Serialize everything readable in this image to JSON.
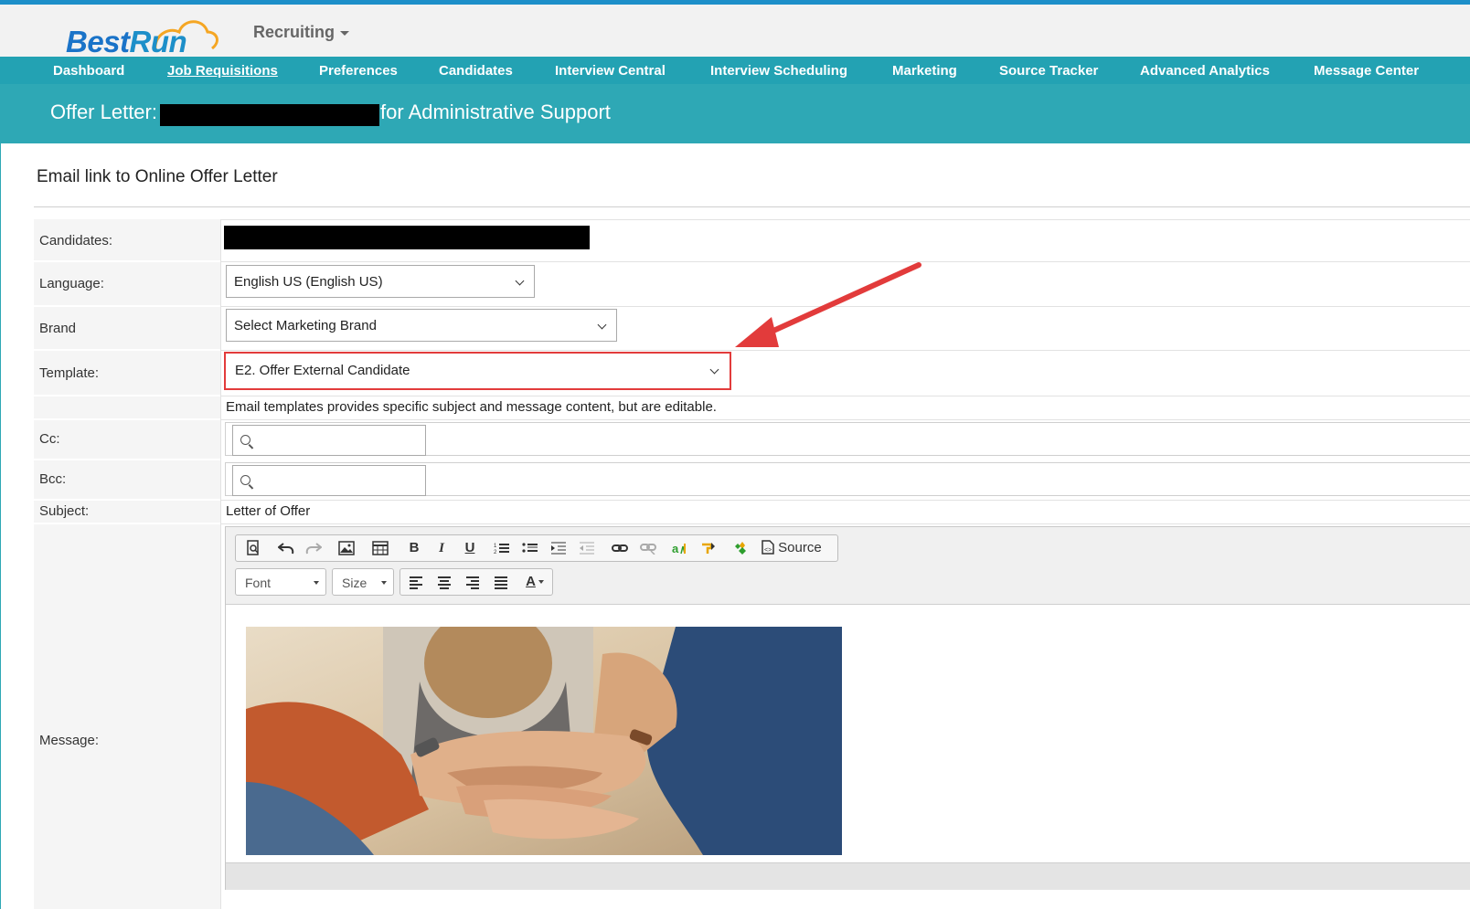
{
  "header": {
    "logo": {
      "part1": "Best",
      "part2": "Run"
    },
    "module_label": "Recruiting"
  },
  "nav": {
    "items": [
      {
        "label": "Dashboard"
      },
      {
        "label": "Job Requisitions"
      },
      {
        "label": "Preferences"
      },
      {
        "label": "Candidates"
      },
      {
        "label": "Interview Central"
      },
      {
        "label": "Interview Scheduling"
      },
      {
        "label": "Marketing"
      },
      {
        "label": "Source Tracker"
      },
      {
        "label": "Advanced Analytics"
      },
      {
        "label": "Message Center"
      }
    ],
    "active_index": 1
  },
  "page": {
    "title_prefix": "Offer Letter:",
    "title_suffix": "for Administrative Support"
  },
  "form": {
    "section_title": "Email link to Online Offer Letter",
    "candidates_label": "Candidates:",
    "language_label": "Language:",
    "language_value": "English US (English US)",
    "brand_label": "Brand",
    "brand_value": "Select Marketing Brand",
    "template_label": "Template:",
    "template_value": "E2. Offer External Candidate",
    "template_hint": "Email templates provides specific subject and message content, but are editable.",
    "cc_label": "Cc:",
    "bcc_label": "Bcc:",
    "subject_label": "Subject:",
    "subject_value": "Letter of Offer",
    "message_label": "Message:"
  },
  "editor": {
    "source_label": "Source",
    "font_label": "Font",
    "size_label": "Size",
    "bold": "B",
    "italic": "I",
    "underline": "U",
    "text_color": "A"
  },
  "colors": {
    "brand_blue": "#1a73c8",
    "nav_teal": "#23a2b3",
    "title_teal": "#2ea8b5",
    "highlight_red": "#e23b3b"
  }
}
